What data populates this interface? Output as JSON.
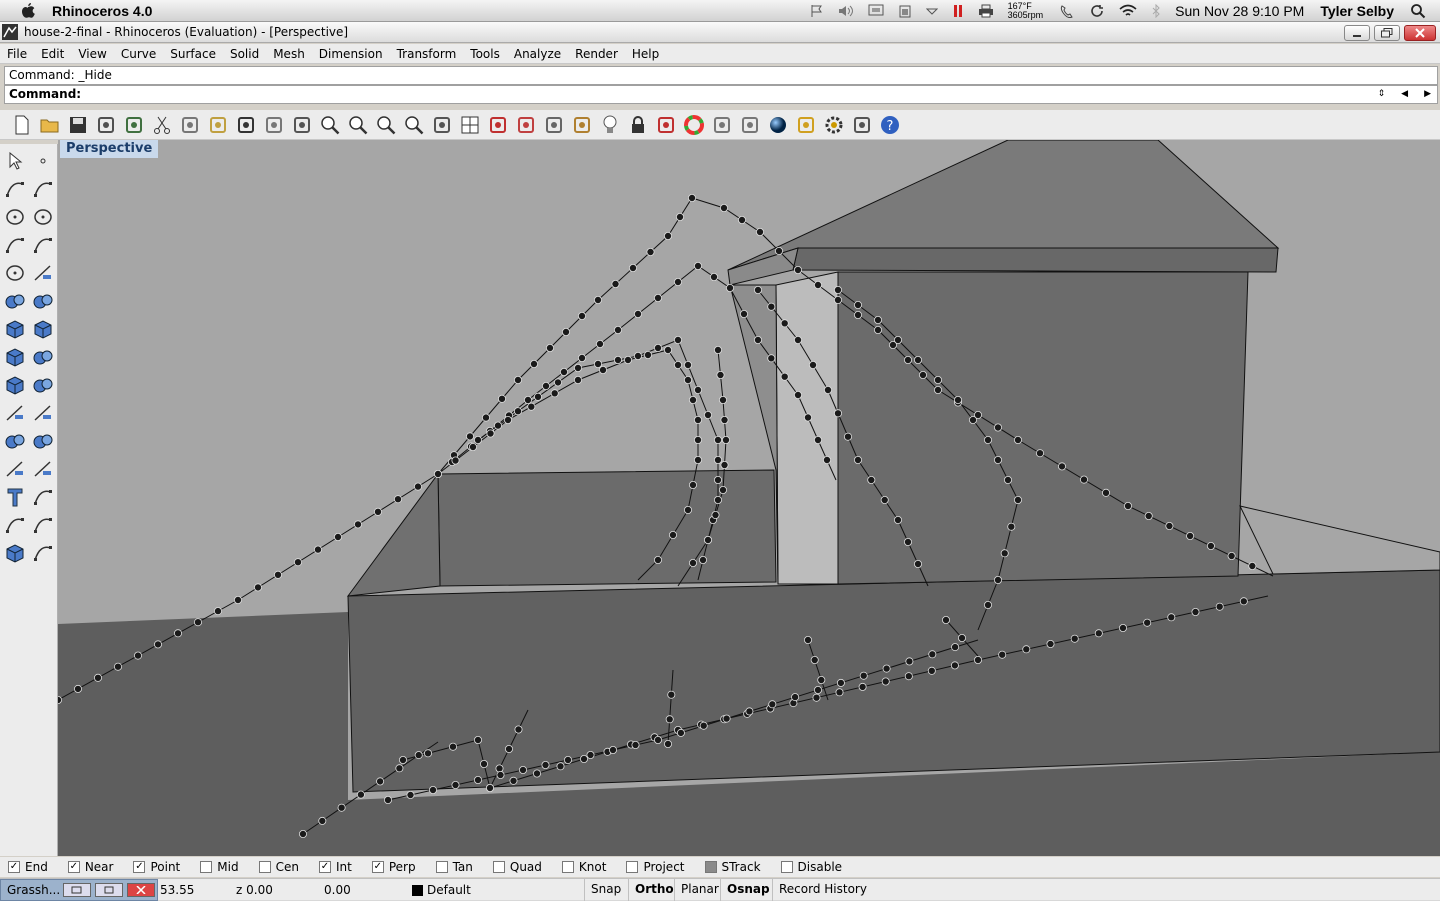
{
  "mac_menubar": {
    "app_name": "Rhinoceros 4.0",
    "temperature": "167°F",
    "fan_speed": "3605rpm",
    "clock": "Sun Nov 28  9:10 PM",
    "user": "Tyler Selby",
    "icons": [
      "flag-icon",
      "volume-icon",
      "display-icon",
      "battery-icon",
      "eject-icon",
      "pause-icon",
      "printer-icon",
      "phone-icon",
      "sync-icon",
      "wifi-icon",
      "bluetooth-icon",
      "spotlight-icon"
    ]
  },
  "window": {
    "title": "house-2-final - Rhinoceros (Evaluation) - [Perspective]"
  },
  "menu": [
    "File",
    "Edit",
    "View",
    "Curve",
    "Surface",
    "Solid",
    "Mesh",
    "Dimension",
    "Transform",
    "Tools",
    "Analyze",
    "Render",
    "Help"
  ],
  "command": {
    "history": "Command: _Hide",
    "prompt": "Command:"
  },
  "toolbar_icons": [
    "new-icon",
    "open-icon",
    "save-icon",
    "print-icon",
    "import-icon",
    "cut-icon",
    "copy-icon",
    "paste-icon",
    "undo-icon",
    "pan-icon",
    "rotate-icon",
    "zoom-icon",
    "zoom-window-icon",
    "zoom-extents-icon",
    "zoom-selected-icon",
    "rotate-view-icon",
    "four-views-icon",
    "car-icon",
    "grid-icon",
    "circle-icon",
    "points-icon",
    "light-icon",
    "lock-icon",
    "layer-icon",
    "color-wheel-icon",
    "shade-icon",
    "render-icon",
    "sphere-icon",
    "pointer-icon",
    "gear-icon",
    "options-icon",
    "help-icon"
  ],
  "left_tool_icons": [
    "select-icon",
    "point-icon",
    "polyline-icon",
    "curve-icon",
    "circle-icon",
    "ellipse-icon",
    "arc-icon",
    "rectangle-icon",
    "polygon-icon",
    "fillet-icon",
    "surface-icon",
    "revolve-icon",
    "box-icon",
    "sphere-icon",
    "cylinder-icon",
    "patch-icon",
    "mesh-icon",
    "explode-icon",
    "trim-icon",
    "split-icon",
    "boolean-icon",
    "group-icon",
    "extend-icon",
    "offset-icon",
    "text-icon",
    "transform-icon",
    "array-icon",
    "dimension-icon",
    "render-box-icon",
    "hatch-icon"
  ],
  "viewport": {
    "label": "Perspective"
  },
  "osnaps": [
    {
      "label": "End",
      "checked": true
    },
    {
      "label": "Near",
      "checked": true
    },
    {
      "label": "Point",
      "checked": true
    },
    {
      "label": "Mid",
      "checked": false
    },
    {
      "label": "Cen",
      "checked": false
    },
    {
      "label": "Int",
      "checked": true
    },
    {
      "label": "Perp",
      "checked": true
    },
    {
      "label": "Tan",
      "checked": false
    },
    {
      "label": "Quad",
      "checked": false
    },
    {
      "label": "Knot",
      "checked": false
    },
    {
      "label": "Project",
      "checked": false
    },
    {
      "label": "STrack",
      "checked": true
    },
    {
      "label": "Disable",
      "checked": false
    }
  ],
  "status": {
    "taskbar_item": "Grassh...",
    "x": "53.55",
    "z": "z 0.00",
    "d": "0.00",
    "layer": "Default",
    "panes": [
      "Snap",
      "Ortho",
      "Planar",
      "Osnap",
      "Record History"
    ],
    "active_panes": [
      "Ortho",
      "Osnap"
    ]
  },
  "colors": {
    "viewport_bg": "#a6a6a6",
    "wall": "#6b6b6b",
    "ground": "#5e5e5e",
    "label_bg": "#c9d9ec"
  }
}
